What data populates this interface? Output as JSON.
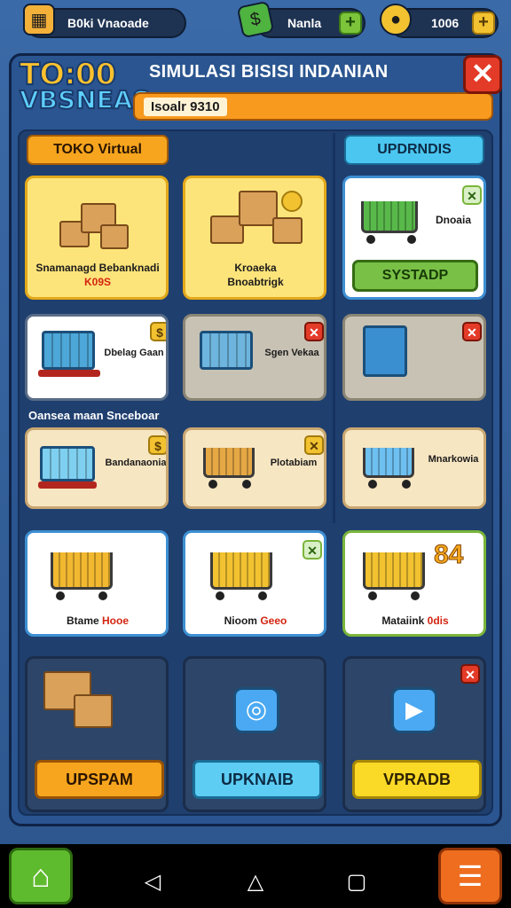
{
  "hud": {
    "player_name": "B0ki Vnaoade",
    "cash_label": "Nanla",
    "coins_label": "1006",
    "plus_symbol": "+"
  },
  "header": {
    "logo_line1": "TO:00",
    "logo_line2": "VBSNEAS",
    "title": "SIMULASI BISISI INDANIAN",
    "subtitle": "Isoalr 9310",
    "close_symbol": "✕"
  },
  "sections": {
    "toko_label": "TOKO Virtual",
    "upgrades_label": "UPDRNDIS",
    "mid_label": "Oansea maan Snceboar"
  },
  "cards": [
    {
      "line1": "Snamanagd Bebanknadi",
      "line2": "K09S"
    },
    {
      "line1": "Kroaeka",
      "line2": "Bnoabtrigk"
    },
    {
      "line1": "Dnoaia",
      "button": "SYSTADP",
      "badge": "✕"
    },
    {
      "line1": "Dbelag Gaan",
      "badge": "$"
    },
    {
      "line1": "Sgen Vekaa",
      "badge": "✕"
    },
    {
      "badge": "✕"
    },
    {
      "line1": "Bandanaonia",
      "badge": "$"
    },
    {
      "line1": "Plotabiam",
      "badge": "✕"
    },
    {
      "line1": "Mnarkowia"
    },
    {
      "line1": "Btame",
      "line1_red": "Hooe"
    },
    {
      "line1": "Nioom",
      "line1_red": "Geeo",
      "badge": "✕"
    },
    {
      "line1": "Mataiink",
      "line1_red": "0dis",
      "number": "84"
    },
    {
      "button": "UPSPAM"
    },
    {
      "button": "UPKNAIB"
    },
    {
      "button": "VPRADB",
      "badge": "✕"
    }
  ],
  "nav": {
    "home_icon": "⌂",
    "back_icon": "◁",
    "home_key": "△",
    "recent_icon": "▢",
    "menu_icon": "☰"
  },
  "colors": {
    "panel_bg": "#2a5590",
    "accent_orange": "#f7a51e",
    "accent_blue": "#4bc6f0",
    "close_red": "#e33b28"
  }
}
